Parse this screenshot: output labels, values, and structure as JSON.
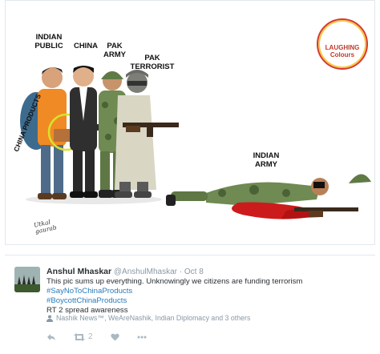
{
  "cartoon": {
    "labels": {
      "indian_public": "INDIAN\nPUBLIC",
      "china": "CHINA",
      "pak_army": "PAK\nARMY",
      "pak_terrorist": "PAK\nTERRORIST",
      "indian_army": "INDIAN\nARMY",
      "china_products": "CHINA PRODUCTS"
    },
    "logo_text": "LAUGHING\nColours",
    "signature": "Utkal\ngaurab"
  },
  "tweet": {
    "author_name": "Anshul Mhaskar",
    "author_handle": "@AnshulMhaskar",
    "separator": "·",
    "time": "Oct 8",
    "text_line": "This pic sums up everything. Unknowingly we citizens are funding terrorism",
    "hashtags": [
      "#SayNoToChinaProducts",
      "#BoycottChinaProducts"
    ],
    "text_line_2": "RT 2 spread awareness",
    "context": "Nashik News™, WeAreNashik, Indian Diplomacy and 3 others",
    "retweet_count": "2",
    "icons": {
      "reply": "reply-icon",
      "retweet": "retweet-icon",
      "like": "heart-icon",
      "more": "more-icon",
      "context": "person-icon"
    },
    "colors": {
      "hashtag": "#2a7ab8",
      "muted": "#8899a6",
      "text": "#292f33"
    }
  }
}
